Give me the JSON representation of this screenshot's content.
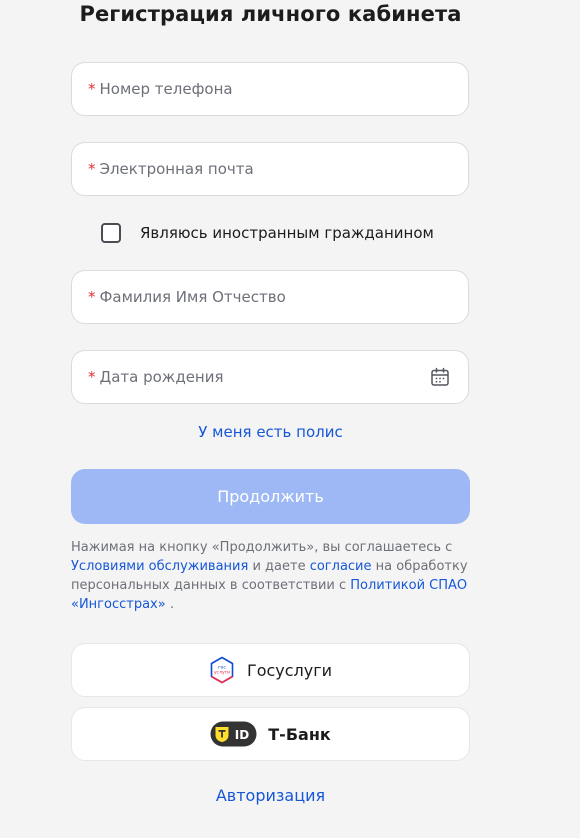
{
  "form": {
    "title": "Регистрация личного кабинета",
    "required_mark": "*",
    "phone_placeholder": "Номер телефона",
    "email_placeholder": "Электронная почта",
    "foreign_citizen_label": "Являюсь иностранным гражданином",
    "foreign_citizen_checked": false,
    "fio_placeholder": "Фамилия Имя Отчество",
    "birthdate_placeholder": "Дата рождения",
    "have_policy_link": "У меня есть полис",
    "continue_button": "Продолжить"
  },
  "agreement": {
    "text_1": "Нажимая на кнопку «Продолжить», вы соглашаетесь с ",
    "link_terms": "Условиями обслуживания",
    "text_2": " и даете ",
    "link_consent": "согласие",
    "text_3": " на обработку персональных данных в соответствии с ",
    "link_policy": "Политикой СПАО «Ингосстрах»",
    "text_4": " ."
  },
  "social": {
    "gosuslugi_label": "Госуслуги",
    "gosuslugi_logo_text_top": "гос",
    "gosuslugi_logo_text_bottom": "услуги",
    "tbank_label": "Т-Банк",
    "tbank_logo_text": "ID"
  },
  "footer": {
    "auth_link": "Авторизация"
  },
  "colors": {
    "accent": "#1557d6",
    "required": "#e0343b",
    "button_disabled": "#9db8f4",
    "tbank_yellow": "#ffdd2d"
  }
}
